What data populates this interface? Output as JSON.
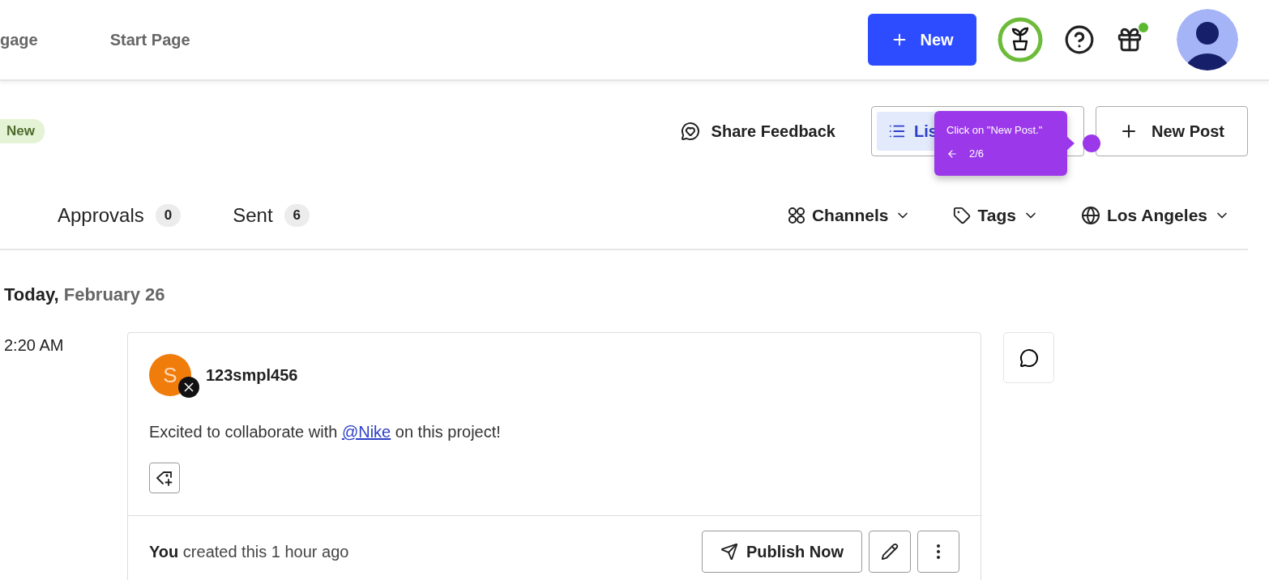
{
  "nav": {
    "items": [
      {
        "label": "gage"
      },
      {
        "label": "Start Page"
      }
    ],
    "new_button": "New",
    "gift_dot": true
  },
  "toolbar": {
    "badge": "New",
    "share_feedback": "Share Feedback",
    "view_toggle": [
      {
        "label": "Lis",
        "selected": true
      }
    ],
    "new_post": "New Post"
  },
  "tooltip": {
    "text": "Click on \"New Post.\"",
    "step": "2/6"
  },
  "tabs": [
    {
      "label": "Approvals",
      "count": "0",
      "selected": false
    },
    {
      "label": "Sent",
      "count": "6",
      "selected": false
    }
  ],
  "filters": [
    {
      "kind": "channels",
      "label": "Channels"
    },
    {
      "kind": "tags",
      "label": "Tags"
    },
    {
      "kind": "timezone",
      "label": "Los Angeles"
    }
  ],
  "date_heading": "**Today,** February 26",
  "posts": [
    {
      "time": "2:20 AM",
      "avatar_letter": "S",
      "username": "123smpl456",
      "text_before": "Excited to collaborate with",
      "mention": "@Nike",
      "text_after": "on this project!",
      "footer": "**You** created this 1 hour ago",
      "publish_button": "Publish Now"
    }
  ]
}
